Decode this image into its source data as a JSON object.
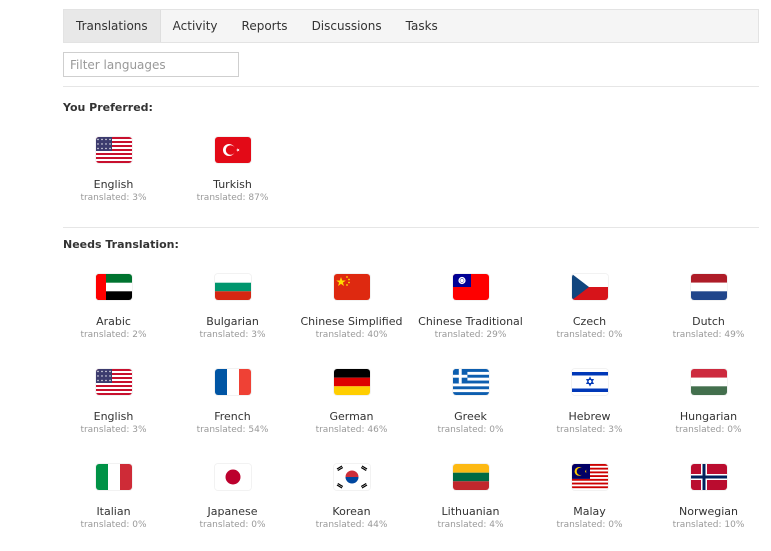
{
  "tabs": [
    {
      "label": "Translations",
      "active": true
    },
    {
      "label": "Activity",
      "active": false
    },
    {
      "label": "Reports",
      "active": false
    },
    {
      "label": "Discussions",
      "active": false
    },
    {
      "label": "Tasks",
      "active": false
    }
  ],
  "filter": {
    "placeholder": "Filter languages",
    "value": ""
  },
  "preferred": {
    "title": "You Preferred:",
    "languages": [
      {
        "name": "English",
        "stat": "translated: 3%",
        "flag": "us-flag-icon"
      },
      {
        "name": "Turkish",
        "stat": "translated: 87%",
        "flag": "tr-flag-icon"
      }
    ]
  },
  "needs": {
    "title": "Needs Translation:",
    "languages": [
      {
        "name": "Arabic",
        "stat": "translated: 2%",
        "flag": "ae-flag-icon"
      },
      {
        "name": "Bulgarian",
        "stat": "translated: 3%",
        "flag": "bg-flag-icon"
      },
      {
        "name": "Chinese Simplified",
        "stat": "translated: 40%",
        "flag": "cn-flag-icon"
      },
      {
        "name": "Chinese Traditional",
        "stat": "translated: 29%",
        "flag": "tw-flag-icon"
      },
      {
        "name": "Czech",
        "stat": "translated: 0%",
        "flag": "cz-flag-icon"
      },
      {
        "name": "Dutch",
        "stat": "translated: 49%",
        "flag": "nl-flag-icon"
      },
      {
        "name": "English",
        "stat": "translated: 3%",
        "flag": "us-flag-icon"
      },
      {
        "name": "French",
        "stat": "translated: 54%",
        "flag": "fr-flag-icon"
      },
      {
        "name": "German",
        "stat": "translated: 46%",
        "flag": "de-flag-icon"
      },
      {
        "name": "Greek",
        "stat": "translated: 0%",
        "flag": "gr-flag-icon"
      },
      {
        "name": "Hebrew",
        "stat": "translated: 3%",
        "flag": "il-flag-icon"
      },
      {
        "name": "Hungarian",
        "stat": "translated: 0%",
        "flag": "hu-flag-icon"
      },
      {
        "name": "Italian",
        "stat": "translated: 0%",
        "flag": "it-flag-icon"
      },
      {
        "name": "Japanese",
        "stat": "translated: 0%",
        "flag": "jp-flag-icon"
      },
      {
        "name": "Korean",
        "stat": "translated: 44%",
        "flag": "kr-flag-icon"
      },
      {
        "name": "Lithuanian",
        "stat": "translated: 4%",
        "flag": "lt-flag-icon"
      },
      {
        "name": "Malay",
        "stat": "translated: 0%",
        "flag": "my-flag-icon"
      },
      {
        "name": "Norwegian",
        "stat": "translated: 10%",
        "flag": "no-flag-icon"
      }
    ]
  }
}
